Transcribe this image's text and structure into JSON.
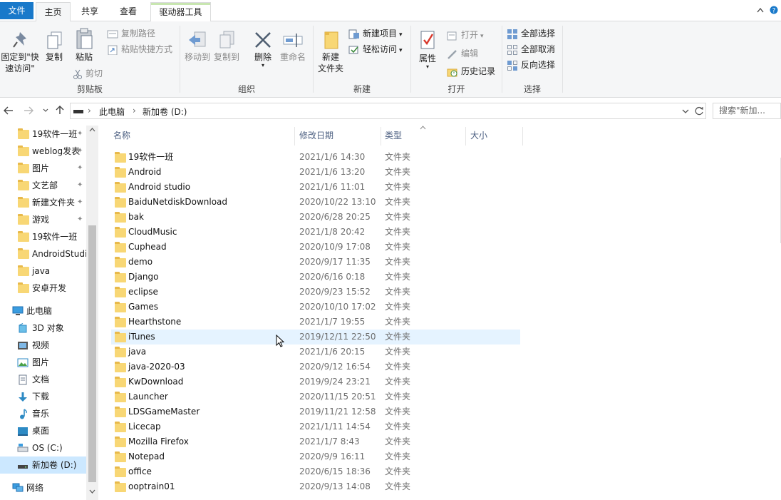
{
  "tabs": {
    "file": "文件",
    "home": "主页",
    "share": "共享",
    "view": "查看",
    "drive_tools": "驱动器工具"
  },
  "window": {
    "expand_icon": "chevron-up-icon"
  },
  "ribbon": {
    "clipboard": {
      "pin": "固定到\"快速访问\"",
      "copy": "复制",
      "paste": "粘贴",
      "copy_path": "复制路径",
      "paste_shortcut": "粘贴快捷方式",
      "cut": "剪切",
      "label": "剪贴板"
    },
    "organize": {
      "move_to": "移动到",
      "copy_to": "复制到",
      "delete": "删除",
      "rename": "重命名",
      "label": "组织"
    },
    "new": {
      "new_folder": "新建\n文件夹",
      "new_item": "新建项目",
      "easy_access": "轻松访问",
      "label": "新建"
    },
    "open": {
      "properties": "属性",
      "open": "打开",
      "edit": "编辑",
      "history": "历史记录",
      "label": "打开"
    },
    "select": {
      "select_all": "全部选择",
      "select_none": "全部取消",
      "invert": "反向选择",
      "label": "选择"
    }
  },
  "address": {
    "crumbs": [
      "此电脑",
      "新加卷 (D:)"
    ],
    "search_placeholder": "搜索\"新加..."
  },
  "nav": {
    "quick_access": [
      {
        "label": "19软件一班"
      },
      {
        "label": "weblog发表"
      },
      {
        "label": "图片"
      },
      {
        "label": "文艺部"
      },
      {
        "label": "新建文件夹"
      },
      {
        "label": "游戏"
      },
      {
        "label": "19软件一班"
      },
      {
        "label": "AndroidStudio"
      },
      {
        "label": "java"
      },
      {
        "label": "安卓开发"
      }
    ],
    "this_pc": "此电脑",
    "pc_items": [
      {
        "label": "3D 对象",
        "icon": "3d-objects-icon"
      },
      {
        "label": "视频",
        "icon": "video-icon"
      },
      {
        "label": "图片",
        "icon": "pictures-icon"
      },
      {
        "label": "文档",
        "icon": "documents-icon"
      },
      {
        "label": "下载",
        "icon": "download-icon"
      },
      {
        "label": "音乐",
        "icon": "music-icon"
      },
      {
        "label": "桌面",
        "icon": "desktop-icon"
      },
      {
        "label": "OS (C:)",
        "icon": "drive-c-icon"
      },
      {
        "label": "新加卷 (D:)",
        "icon": "drive-d-icon"
      }
    ],
    "network": "网络"
  },
  "columns": {
    "name": "名称",
    "date": "修改日期",
    "type": "类型",
    "size": "大小"
  },
  "files": [
    {
      "name": "19软件一班",
      "date": "2021/1/6 14:30",
      "type": "文件夹"
    },
    {
      "name": "Android",
      "date": "2021/1/6 13:20",
      "type": "文件夹"
    },
    {
      "name": "Android studio",
      "date": "2021/1/6 11:01",
      "type": "文件夹"
    },
    {
      "name": "BaiduNetdiskDownload",
      "date": "2020/10/22 13:10",
      "type": "文件夹"
    },
    {
      "name": "bak",
      "date": "2020/6/28 20:25",
      "type": "文件夹"
    },
    {
      "name": "CloudMusic",
      "date": "2021/1/8 20:42",
      "type": "文件夹"
    },
    {
      "name": "Cuphead",
      "date": "2020/10/9 17:08",
      "type": "文件夹"
    },
    {
      "name": "demo",
      "date": "2020/9/17 11:35",
      "type": "文件夹"
    },
    {
      "name": "Django",
      "date": "2020/6/16 0:18",
      "type": "文件夹"
    },
    {
      "name": "eclipse",
      "date": "2020/9/23 15:52",
      "type": "文件夹"
    },
    {
      "name": "Games",
      "date": "2020/10/10 17:02",
      "type": "文件夹"
    },
    {
      "name": "Hearthstone",
      "date": "2021/1/7 19:55",
      "type": "文件夹"
    },
    {
      "name": "iTunes",
      "date": "2019/12/11 22:50",
      "type": "文件夹"
    },
    {
      "name": "java",
      "date": "2021/1/6 20:15",
      "type": "文件夹"
    },
    {
      "name": "java-2020-03",
      "date": "2020/9/12 16:54",
      "type": "文件夹"
    },
    {
      "name": "KwDownload",
      "date": "2019/9/24 23:21",
      "type": "文件夹"
    },
    {
      "name": "Launcher",
      "date": "2020/11/15 20:51",
      "type": "文件夹"
    },
    {
      "name": "LDSGameMaster",
      "date": "2019/11/21 12:58",
      "type": "文件夹"
    },
    {
      "name": "Licecap",
      "date": "2021/1/11 14:54",
      "type": "文件夹"
    },
    {
      "name": "Mozilla Firefox",
      "date": "2021/1/7 8:43",
      "type": "文件夹"
    },
    {
      "name": "Notepad",
      "date": "2020/9/9 16:11",
      "type": "文件夹"
    },
    {
      "name": "office",
      "date": "2020/6/15 18:36",
      "type": "文件夹"
    },
    {
      "name": "ooptrain01",
      "date": "2020/9/13 14:08",
      "type": "文件夹"
    }
  ],
  "hovered_file": "iTunes",
  "colors": {
    "accent": "#1979ca",
    "folder": "#f8d775",
    "selection": "#cce8ff",
    "hover": "#e5f3ff",
    "context_tab": "#c8e6b0"
  }
}
